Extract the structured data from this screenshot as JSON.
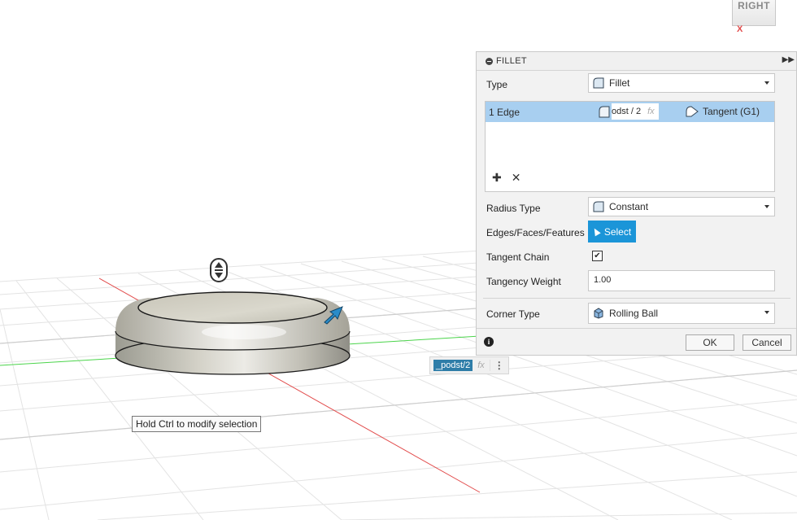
{
  "viewcube": {
    "face_label": "RIGHT",
    "axis_label": "X"
  },
  "tooltip": "Hold Ctrl to modify selection",
  "floating_input": {
    "value": "_podst/2",
    "fx": "fx"
  },
  "dialog": {
    "title": "FILLET",
    "type": {
      "label": "Type",
      "value": "Fillet"
    },
    "edge_row": {
      "label": "1 Edge",
      "radius": "odst / 2",
      "fx": "fx",
      "continuity": "Tangent (G1)"
    },
    "radius_type": {
      "label": "Radius Type",
      "value": "Constant"
    },
    "edges": {
      "label": "Edges/Faces/Features",
      "button": "Select"
    },
    "tangent_chain": {
      "label": "Tangent Chain",
      "checked": true
    },
    "tangency_weight": {
      "label": "Tangency Weight",
      "value": "1.00"
    },
    "corner_type": {
      "label": "Corner Type",
      "value": "Rolling Ball"
    },
    "ok_label": "OK",
    "cancel_label": "Cancel"
  },
  "colors": {
    "selection": "#a8cff0",
    "accent": "#1b95d8",
    "x_axis": "#e24b4b",
    "y_axis": "#4bd44b"
  }
}
